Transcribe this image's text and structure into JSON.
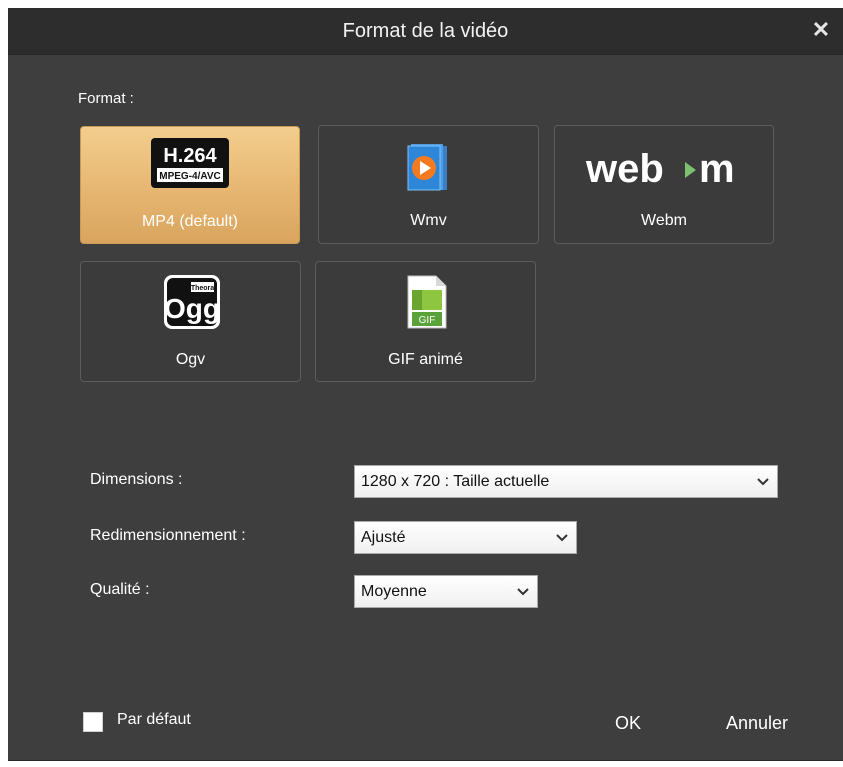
{
  "dialog": {
    "title": "Format de la vidéo",
    "close_icon": "close-icon"
  },
  "format": {
    "label": "Format :",
    "options": [
      {
        "label": "MP4 (default)",
        "icon": "h264-icon",
        "icon_text": "H.264",
        "icon_subtext": "MPEG-4/AVC",
        "selected": true
      },
      {
        "label": "Wmv",
        "icon": "wmv-icon",
        "selected": false
      },
      {
        "label": "Webm",
        "icon": "webm-logo-icon",
        "icon_text_a": "web",
        "icon_text_b": "m",
        "selected": false
      },
      {
        "label": "Ogv",
        "icon": "ogg-theora-icon",
        "icon_text": "Ogg",
        "icon_subtext": "Theora",
        "selected": false
      },
      {
        "label": "GIF animé",
        "icon": "gif-file-icon",
        "icon_text": "GIF",
        "selected": false
      }
    ]
  },
  "settings": {
    "dimensions": {
      "label": "Dimensions :",
      "value": "1280 x 720 : Taille actuelle"
    },
    "resize": {
      "label": "Redimensionnement :",
      "value": "Ajusté"
    },
    "quality": {
      "label": "Qualité :",
      "value": "Moyenne"
    }
  },
  "footer": {
    "default_checkbox": {
      "label": "Par défaut",
      "checked": false
    },
    "ok_label": "OK",
    "cancel_label": "Annuler"
  },
  "colors": {
    "dialog_bg": "#3e3e3e",
    "titlebar_bg": "#2d2d2d",
    "selected_tile": "#e6b671"
  }
}
